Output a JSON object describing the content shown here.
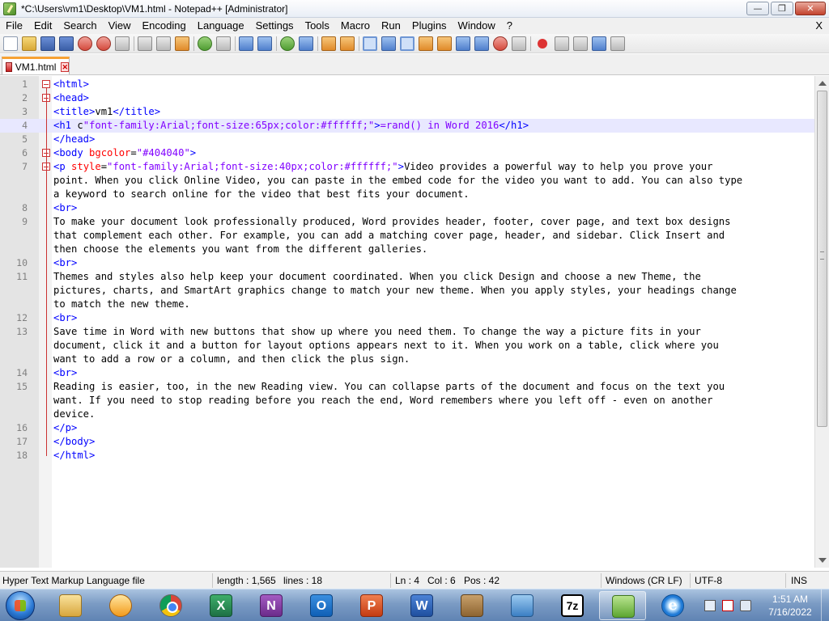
{
  "window": {
    "title": "*C:\\Users\\vm1\\Desktop\\VM1.html - Notepad++ [Administrator]",
    "minimize_label": "—",
    "maximize_label": "❐",
    "close_label": "✕"
  },
  "menu": {
    "items": [
      "File",
      "Edit",
      "Search",
      "View",
      "Encoding",
      "Language",
      "Settings",
      "Tools",
      "Macro",
      "Run",
      "Plugins",
      "Window",
      "?"
    ],
    "close_doc": "X"
  },
  "tabs": [
    {
      "label": "VM1.html",
      "close": "✕"
    }
  ],
  "editor": {
    "current_line": 4,
    "lines": [
      {
        "num": "1",
        "fold": true,
        "segments": [
          {
            "t": "tag",
            "s": "<html>"
          }
        ]
      },
      {
        "num": "2",
        "fold": true,
        "segments": [
          {
            "t": "tag",
            "s": "<head>"
          }
        ]
      },
      {
        "num": "3",
        "fold": false,
        "segments": [
          {
            "t": "tag",
            "s": "<title>"
          },
          {
            "t": "ent",
            "s": "vm1"
          },
          {
            "t": "tag",
            "s": "</title>"
          }
        ]
      },
      {
        "num": "4",
        "fold": false,
        "segments": [
          {
            "t": "tag",
            "s": "<h1 "
          },
          {
            "t": "ent",
            "s": "c"
          },
          {
            "t": "val",
            "s": "\"font-family:Arial;font-size:65px;color:#ffffff;\""
          },
          {
            "t": "tag",
            "s": ">"
          },
          {
            "t": "val",
            "s": "=rand() in Word 2016"
          },
          {
            "t": "tag",
            "s": "</h1>"
          }
        ]
      },
      {
        "num": "5",
        "fold": false,
        "segments": [
          {
            "t": "tag",
            "s": "</head>"
          }
        ]
      },
      {
        "num": "6",
        "fold": true,
        "segments": [
          {
            "t": "tag",
            "s": "<body "
          },
          {
            "t": "attr",
            "s": "bgcolor"
          },
          {
            "t": "ent",
            "s": "="
          },
          {
            "t": "val",
            "s": "\"#404040\""
          },
          {
            "t": "tag",
            "s": ">"
          }
        ]
      },
      {
        "num": "7",
        "fold": true,
        "segments": [
          {
            "t": "tag",
            "s": "<p "
          },
          {
            "t": "attr",
            "s": "style"
          },
          {
            "t": "ent",
            "s": "="
          },
          {
            "t": "val",
            "s": "\"font-family:Arial;font-size:40px;color:#ffffff;\""
          },
          {
            "t": "tag",
            "s": ">"
          },
          {
            "t": "ent",
            "s": "Video provides a powerful way to help you prove your"
          }
        ]
      },
      {
        "num": "",
        "fold": false,
        "segments": [
          {
            "t": "ent",
            "s": "point. When you click Online Video, you can paste in the embed code for the video you want to add. You can also type"
          }
        ]
      },
      {
        "num": "",
        "fold": false,
        "segments": [
          {
            "t": "ent",
            "s": "a keyword to search online for the video that best fits your document."
          }
        ]
      },
      {
        "num": "8",
        "fold": false,
        "segments": [
          {
            "t": "tag",
            "s": "<br>"
          }
        ]
      },
      {
        "num": "9",
        "fold": false,
        "segments": [
          {
            "t": "ent",
            "s": "To make your document look professionally produced, Word provides header, footer, cover page, and text box designs"
          }
        ]
      },
      {
        "num": "",
        "fold": false,
        "segments": [
          {
            "t": "ent",
            "s": "that complement each other. For example, you can add a matching cover page, header, and sidebar. Click Insert and"
          }
        ]
      },
      {
        "num": "",
        "fold": false,
        "segments": [
          {
            "t": "ent",
            "s": "then choose the elements you want from the different galleries."
          }
        ]
      },
      {
        "num": "10",
        "fold": false,
        "segments": [
          {
            "t": "tag",
            "s": "<br>"
          }
        ]
      },
      {
        "num": "11",
        "fold": false,
        "segments": [
          {
            "t": "ent",
            "s": "Themes and styles also help keep your document coordinated. When you click Design and choose a new Theme, the"
          }
        ]
      },
      {
        "num": "",
        "fold": false,
        "segments": [
          {
            "t": "ent",
            "s": "pictures, charts, and SmartArt graphics change to match your new theme. When you apply styles, your headings change"
          }
        ]
      },
      {
        "num": "",
        "fold": false,
        "segments": [
          {
            "t": "ent",
            "s": "to match the new theme."
          }
        ]
      },
      {
        "num": "12",
        "fold": false,
        "segments": [
          {
            "t": "tag",
            "s": "<br>"
          }
        ]
      },
      {
        "num": "13",
        "fold": false,
        "segments": [
          {
            "t": "ent",
            "s": "Save time in Word with new buttons that show up where you need them. To change the way a picture fits in your"
          }
        ]
      },
      {
        "num": "",
        "fold": false,
        "segments": [
          {
            "t": "ent",
            "s": "document, click it and a button for layout options appears next to it. When you work on a table, click where you"
          }
        ]
      },
      {
        "num": "",
        "fold": false,
        "segments": [
          {
            "t": "ent",
            "s": "want to add a row or a column, and then click the plus sign."
          }
        ]
      },
      {
        "num": "14",
        "fold": false,
        "segments": [
          {
            "t": "tag",
            "s": "<br>"
          }
        ]
      },
      {
        "num": "15",
        "fold": false,
        "segments": [
          {
            "t": "ent",
            "s": "Reading is easier, too, in the new Reading view. You can collapse parts of the document and focus on the text you"
          }
        ]
      },
      {
        "num": "",
        "fold": false,
        "segments": [
          {
            "t": "ent",
            "s": "want. If you need to stop reading before you reach the end, Word remembers where you left off - even on another"
          }
        ]
      },
      {
        "num": "",
        "fold": false,
        "segments": [
          {
            "t": "ent",
            "s": "device."
          }
        ]
      },
      {
        "num": "16",
        "fold": false,
        "segments": [
          {
            "t": "tag",
            "s": "</p>"
          }
        ]
      },
      {
        "num": "17",
        "fold": false,
        "segments": [
          {
            "t": "tag",
            "s": "</body>"
          }
        ]
      },
      {
        "num": "18",
        "fold": false,
        "segments": [
          {
            "t": "tag",
            "s": "</html>"
          }
        ]
      }
    ]
  },
  "status": {
    "filetype": "Hyper Text Markup Language file",
    "length": "length : 1,565",
    "lines": "lines : 18",
    "ln": "Ln : 4",
    "col": "Col : 6",
    "pos": "Pos : 42",
    "eol": "Windows (CR LF)",
    "encoding": "UTF-8",
    "mode": "INS"
  },
  "taskbar": {
    "apps": [
      "explorer",
      "media-player",
      "chrome",
      "excel",
      "onenote",
      "outlook",
      "powerpoint",
      "word",
      "archive-tool",
      "remote-monitor",
      "7zip",
      "notepad-plus-plus",
      "internet-explorer"
    ],
    "app_glyphs": {
      "excel": "X",
      "onenote": "N",
      "outlook": "O",
      "powerpoint": "P",
      "word": "W",
      "7zip": "7z",
      "internet-explorer": "e"
    },
    "time": "1:51 AM",
    "date": "7/16/2022"
  }
}
